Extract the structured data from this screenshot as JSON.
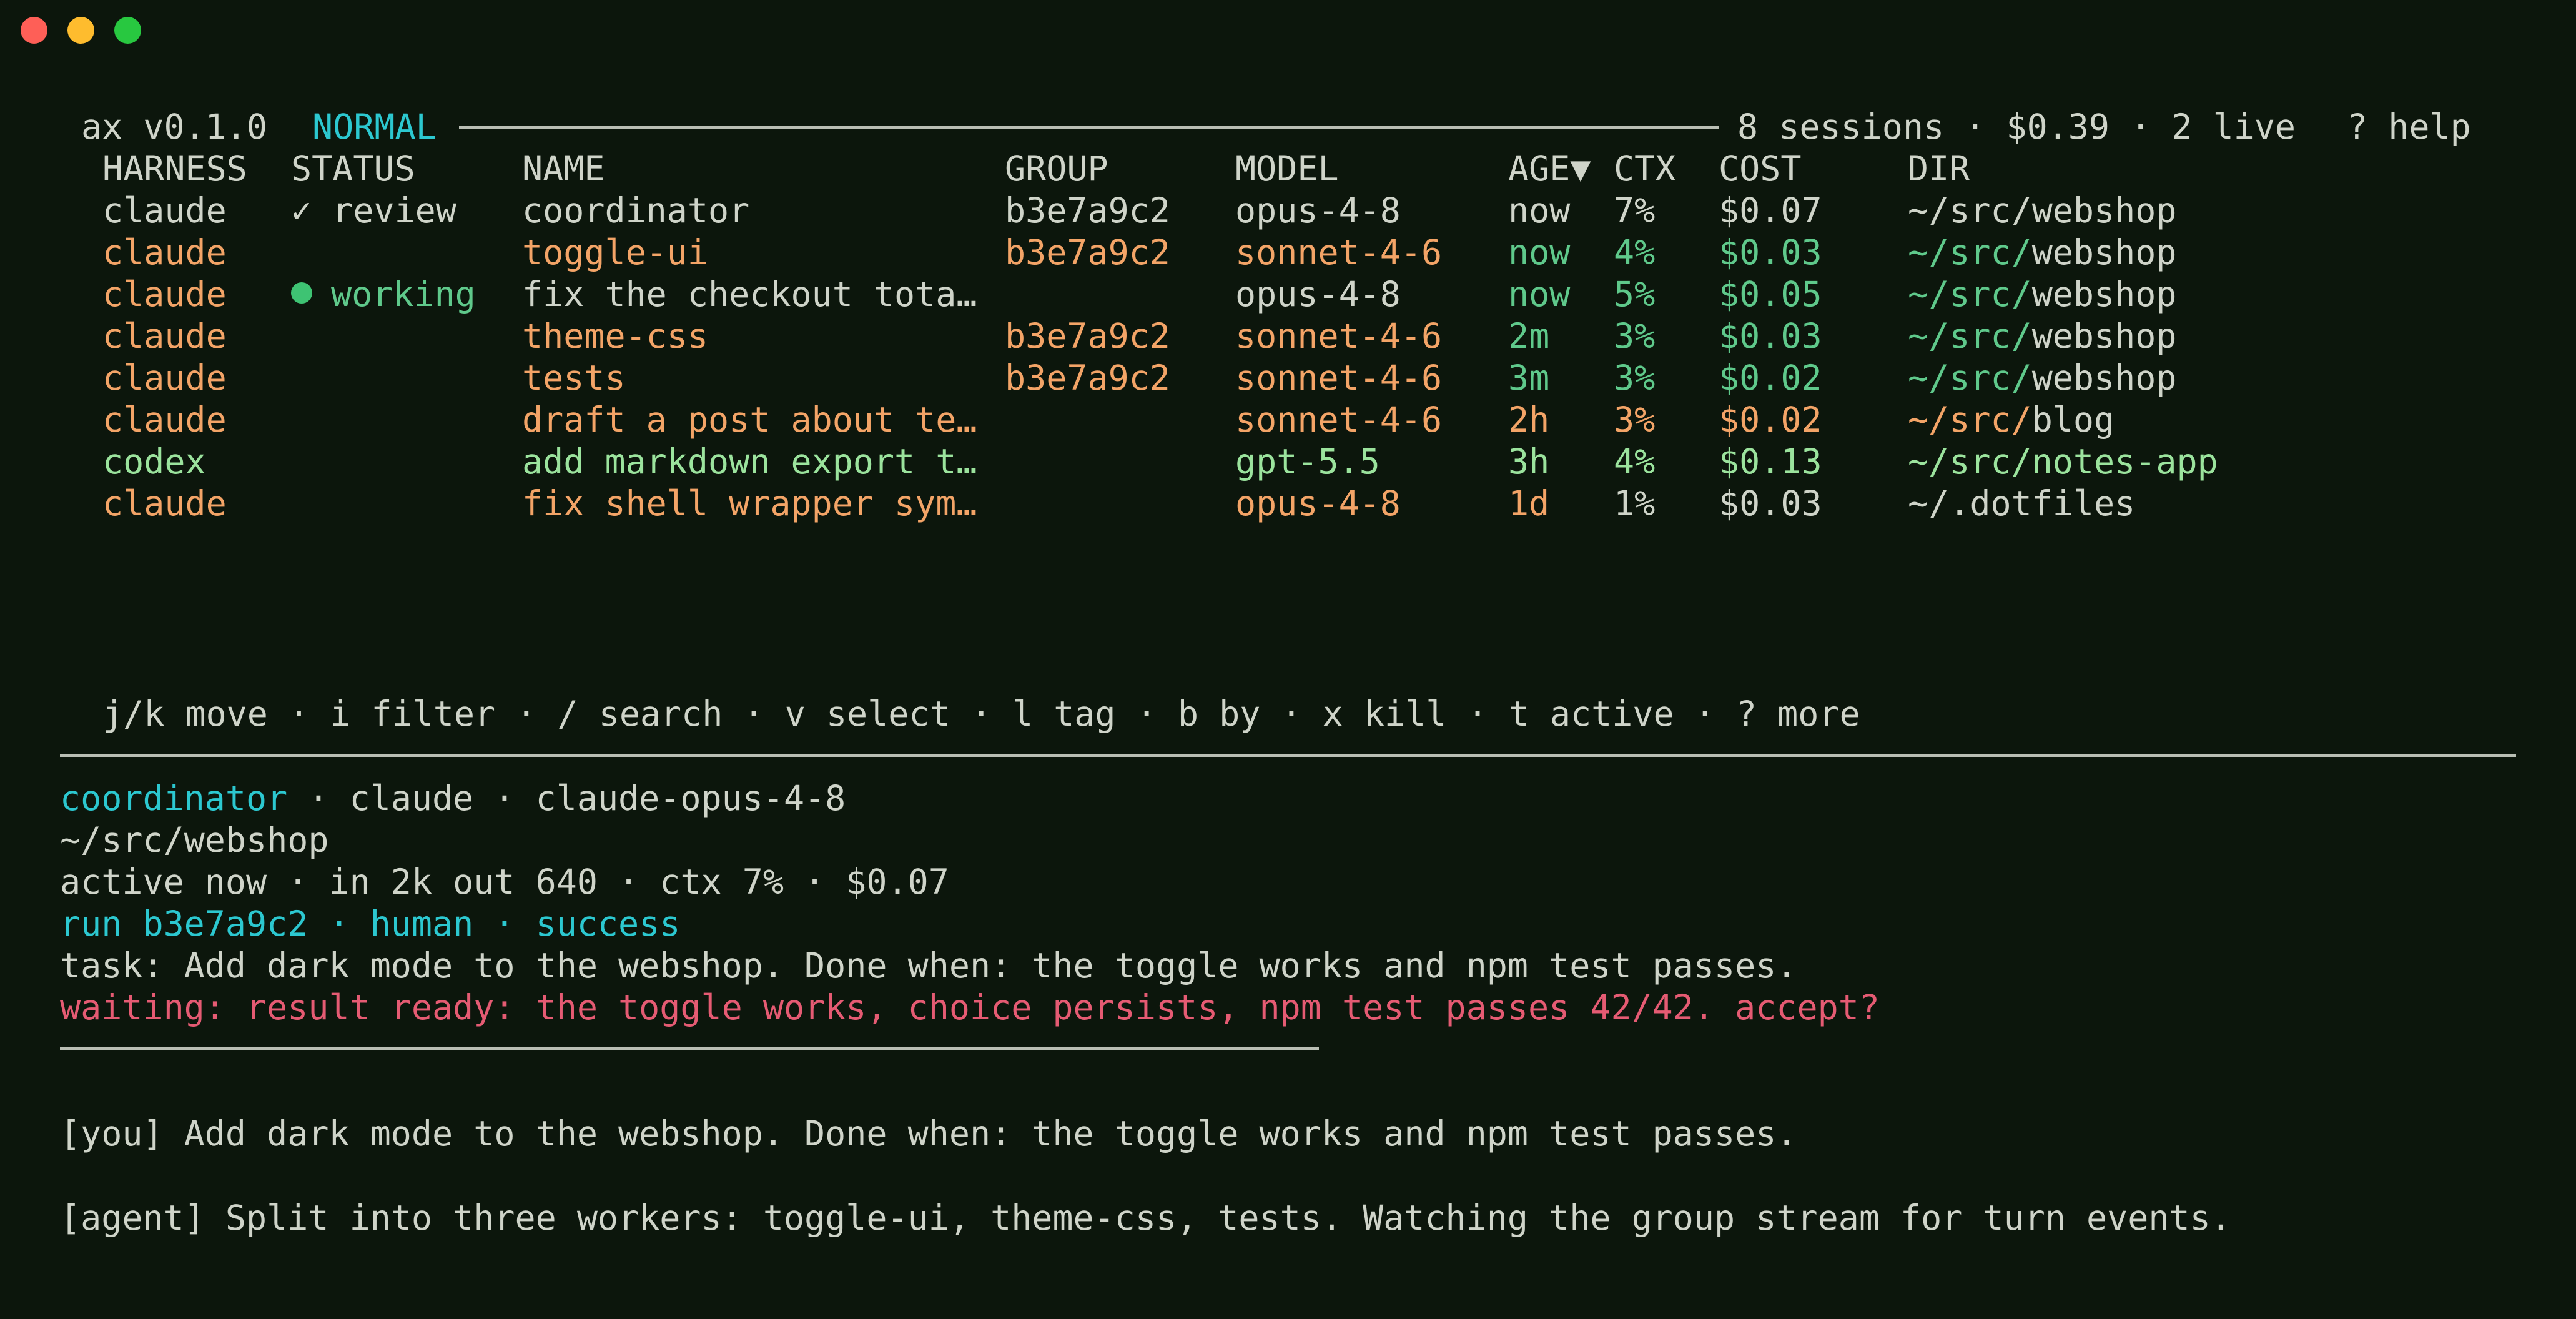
{
  "window": {
    "controls": [
      "close",
      "minimize",
      "zoom"
    ]
  },
  "header": {
    "app": "ax v0.1.0",
    "mode": "NORMAL",
    "summary": "8 sessions · $0.39 · 2 live",
    "help": "? help"
  },
  "table": {
    "columns": [
      "HARNESS",
      "STATUS",
      "NAME",
      "GROUP",
      "MODEL",
      "AGE▼",
      "CTX",
      "COST",
      "DIR"
    ],
    "rows": [
      {
        "harness": "claude",
        "status": "✓ review",
        "name": "coordinator",
        "group": "b3e7a9c2",
        "model": "opus-4-8",
        "age": "now",
        "ctx": "7%",
        "cost": "$0.07",
        "dir_prefix": "~/src/",
        "dir_name": "webshop"
      },
      {
        "harness": "claude",
        "status": "",
        "name": "toggle-ui",
        "group": "b3e7a9c2",
        "model": "sonnet-4-6",
        "age": "now",
        "ctx": "4%",
        "cost": "$0.03",
        "dir_prefix": "~/src/",
        "dir_name": "webshop"
      },
      {
        "harness": "claude",
        "status": "working",
        "name": "fix the checkout tota…",
        "group": "",
        "model": "opus-4-8",
        "age": "now",
        "ctx": "5%",
        "cost": "$0.05",
        "dir_prefix": "~/src/",
        "dir_name": "webshop"
      },
      {
        "harness": "claude",
        "status": "",
        "name": "theme-css",
        "group": "b3e7a9c2",
        "model": "sonnet-4-6",
        "age": "2m",
        "ctx": "3%",
        "cost": "$0.03",
        "dir_prefix": "~/src/",
        "dir_name": "webshop"
      },
      {
        "harness": "claude",
        "status": "",
        "name": "tests",
        "group": "b3e7a9c2",
        "model": "sonnet-4-6",
        "age": "3m",
        "ctx": "3%",
        "cost": "$0.02",
        "dir_prefix": "~/src/",
        "dir_name": "webshop"
      },
      {
        "harness": "claude",
        "status": "",
        "name": "draft a post about te…",
        "group": "",
        "model": "sonnet-4-6",
        "age": "2h",
        "ctx": "3%",
        "cost": "$0.02",
        "dir_prefix": "~/src/",
        "dir_name": "blog"
      },
      {
        "harness": "codex",
        "status": "",
        "name": "add markdown export t…",
        "group": "",
        "model": "gpt-5.5",
        "age": "3h",
        "ctx": "4%",
        "cost": "$0.13",
        "dir_prefix": "~/src/",
        "dir_name": "notes-app"
      },
      {
        "harness": "claude",
        "status": "",
        "name": "fix shell wrapper sym…",
        "group": "",
        "model": "opus-4-8",
        "age": "1d",
        "ctx": "1%",
        "cost": "$0.03",
        "dir_prefix": "~/",
        "dir_name": ".dotfiles"
      }
    ]
  },
  "keybar": "j/k move · i filter · / search · v select · l tag · b by · x kill · t active · ? more",
  "detail": {
    "name": "coordinator",
    "meta": " · claude · claude-opus-4-8",
    "dir": "~/src/webshop",
    "stats": "active now · in 2k out 640 · ctx 7% · $0.07",
    "run": "run b3e7a9c2 · human · success",
    "task": "task: Add dark mode to the webshop. Done when: the toggle works and npm test passes.",
    "waiting": "waiting: result ready: the toggle works, choice persists, npm test passes 42/42. accept?"
  },
  "transcript": [
    "[you] Add dark mode to the webshop. Done when: the toggle works and npm test passes.",
    "[agent] Split into three workers: toggle-ui, theme-css, tests. Watching the group stream for turn events."
  ],
  "colors": {
    "background": "#0c160c",
    "text": "#cfd4c9",
    "orange": "#f3a467",
    "green": "#5fc98b",
    "light_green": "#9be39d",
    "cyan": "#2cc8d0",
    "red": "#e55b73"
  }
}
